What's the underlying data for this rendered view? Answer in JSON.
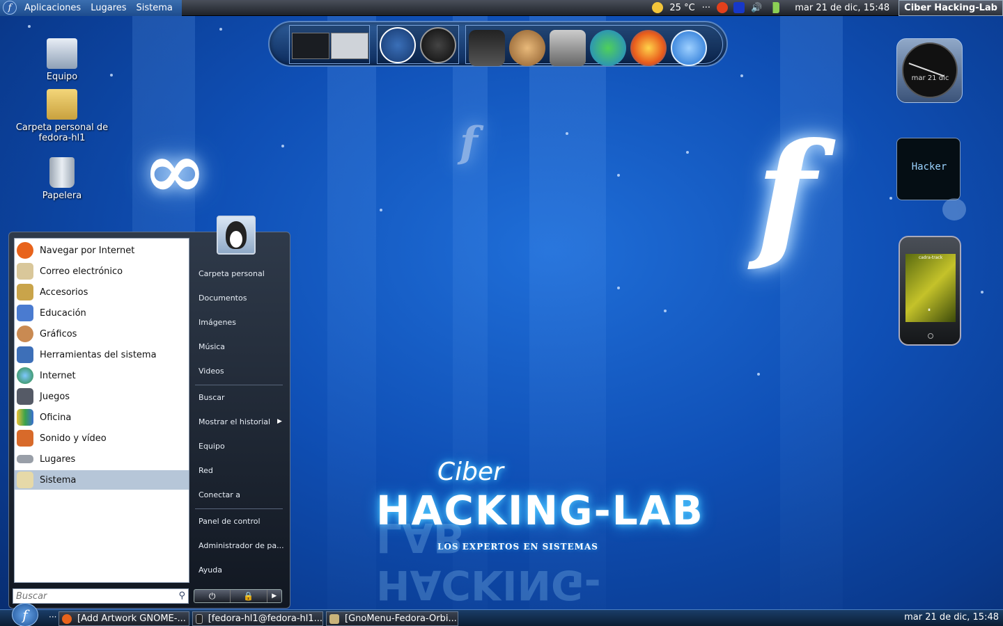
{
  "top_panel": {
    "menus": [
      "Aplicaciones",
      "Lugares",
      "Sistema"
    ],
    "weather": "25 °C",
    "clock": "mar 21 de dic, 15:48",
    "hostname": "Ciber Hacking-Lab"
  },
  "desktop_icons": [
    {
      "label": "Equipo"
    },
    {
      "label": "Carpeta personal de fedora-hl1"
    },
    {
      "label": "Papelera"
    }
  ],
  "widgets": {
    "clock_date": "mar 21 dic",
    "hacker_text": "Hacker",
    "ipod_title": "cadra-track"
  },
  "logo": {
    "small": "Ciber",
    "big": "HACKING-LAB",
    "sub": "LOS EXPERTOS EN SISTEMAS"
  },
  "start_menu": {
    "apps": [
      {
        "label": "Navegar por Internet",
        "color": "#e8631b"
      },
      {
        "label": "Correo electrónico",
        "color": "#d9c79a"
      },
      {
        "label": "Accesorios",
        "color": "#c9a44a"
      },
      {
        "label": "Educación",
        "color": "#4a7bd0"
      },
      {
        "label": "Gráficos",
        "color": "#c98a52"
      },
      {
        "label": "Herramientas del sistema",
        "color": "#3d6fb8"
      },
      {
        "label": "Internet",
        "color": "#2c8a3e"
      },
      {
        "label": "Juegos",
        "color": "#555a66"
      },
      {
        "label": "Oficina",
        "color": "#3aa24a"
      },
      {
        "label": "Sonido y vídeo",
        "color": "#d86a2a"
      },
      {
        "label": "Lugares",
        "color": "#999fa8"
      },
      {
        "label": "Sistema",
        "color": "#e6d9a8"
      }
    ],
    "selected_index": 11,
    "search_placeholder": "Buscar",
    "places": [
      "Carpeta personal",
      "Documentos",
      "Imágenes",
      "Música",
      "Videos",
      "Buscar",
      "Mostrar el historial",
      "Equipo",
      "Red",
      "Conectar a",
      "Panel de control",
      "Administrador de pa...",
      "Ayuda"
    ]
  },
  "taskbar": {
    "tasks": [
      "[Add  Artwork GNOME-...",
      "[fedora-hl1@fedora-hl1...",
      "[GnoMenu-Fedora-Orbi..."
    ],
    "clock": "mar 21 de dic, 15:48"
  },
  "colors": {
    "accent": "#1f6ed8",
    "glow": "#2aa8ff"
  }
}
